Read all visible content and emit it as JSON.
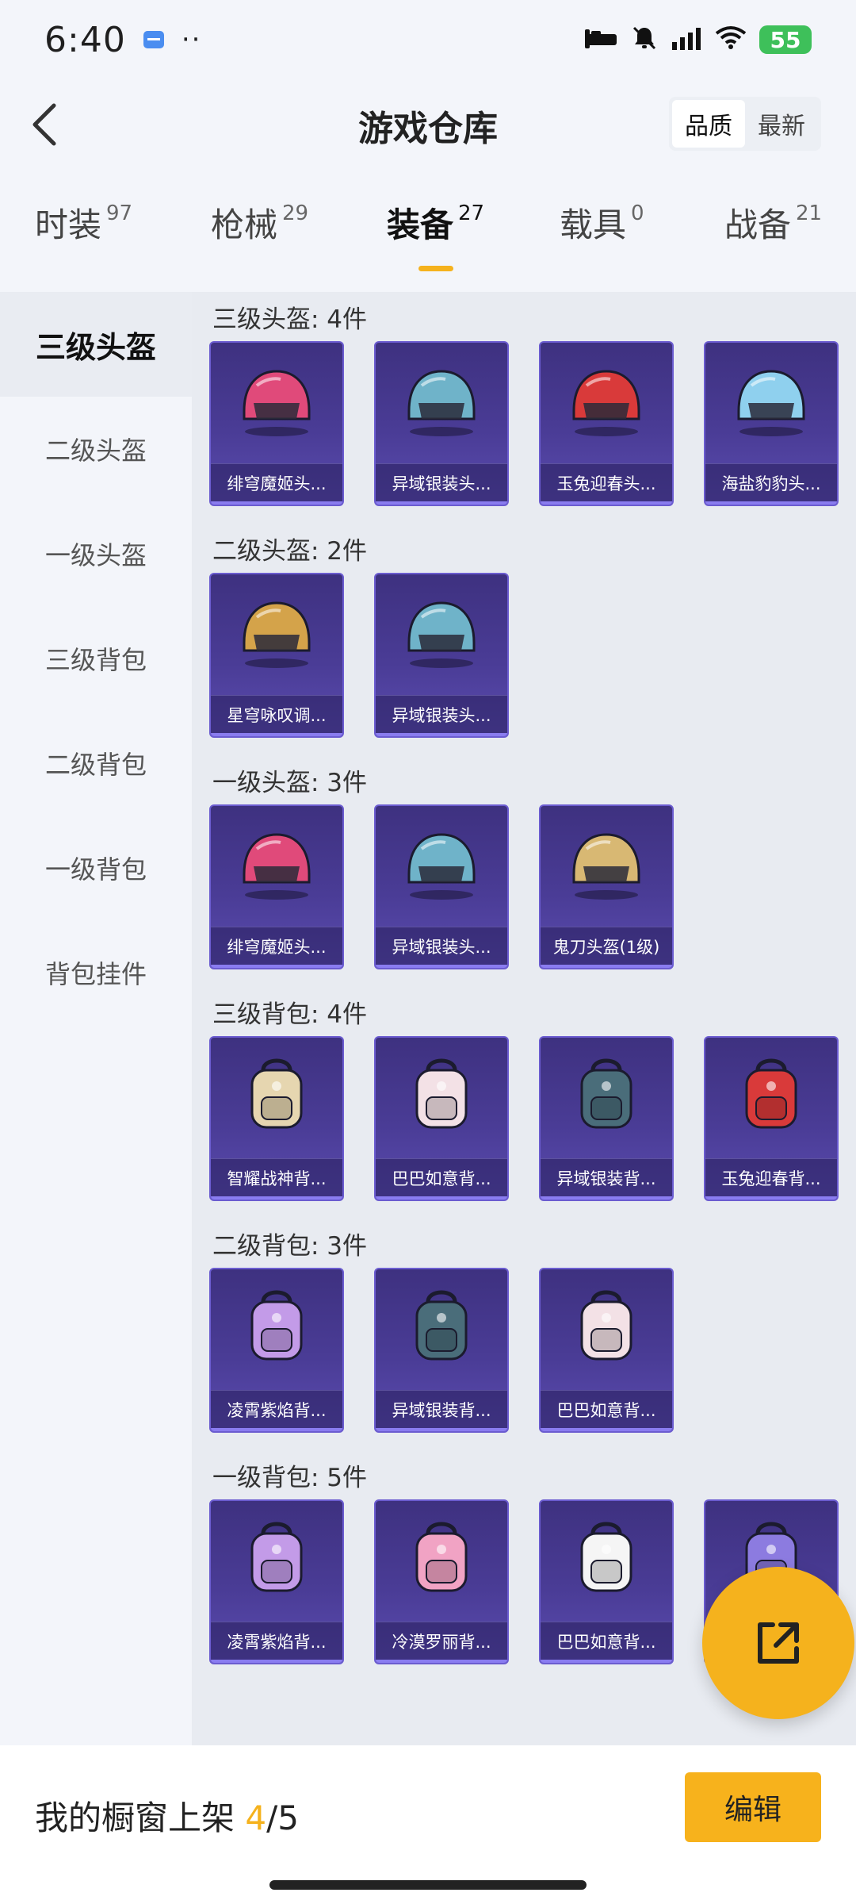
{
  "status_bar": {
    "time": "6:40",
    "dots": "··",
    "battery": "55"
  },
  "header": {
    "title": "游戏仓库",
    "sort_options": [
      "品质",
      "最新"
    ]
  },
  "tabs": [
    {
      "label": "时装",
      "count": "97"
    },
    {
      "label": "枪械",
      "count": "29"
    },
    {
      "label": "装备",
      "count": "27"
    },
    {
      "label": "载具",
      "count": "0"
    },
    {
      "label": "战备",
      "count": "21"
    }
  ],
  "sidebar": {
    "items": [
      "三级头盔",
      "二级头盔",
      "一级头盔",
      "三级背包",
      "二级背包",
      "一级背包",
      "背包挂件"
    ]
  },
  "sections": [
    {
      "title": "三级头盔: 4件",
      "items": [
        {
          "name": "绯穹魔姬头...",
          "icon": "helmet-icon",
          "color": "#e04a7a"
        },
        {
          "name": "异域银装头...",
          "icon": "helmet-icon",
          "color": "#6fb3c9"
        },
        {
          "name": "玉兔迎春头...",
          "icon": "helmet-icon",
          "color": "#d93a3a"
        },
        {
          "name": "海盐豹豹头...",
          "icon": "helmet-icon",
          "color": "#8fd0ee"
        }
      ]
    },
    {
      "title": "二级头盔: 2件",
      "items": [
        {
          "name": "星穹咏叹调...",
          "icon": "helmet-icon",
          "color": "#d4a34a"
        },
        {
          "name": "异域银装头...",
          "icon": "helmet-icon",
          "color": "#6fb3c9"
        }
      ]
    },
    {
      "title": "一级头盔: 3件",
      "items": [
        {
          "name": "绯穹魔姬头...",
          "icon": "helmet-icon",
          "color": "#e04a7a"
        },
        {
          "name": "异域银装头...",
          "icon": "helmet-icon",
          "color": "#6fb3c9"
        },
        {
          "name": "鬼刀头盔(1级)",
          "icon": "helmet-icon",
          "color": "#d8b873"
        }
      ]
    },
    {
      "title": "三级背包: 4件",
      "items": [
        {
          "name": "智耀战神背...",
          "icon": "backpack-icon",
          "color": "#e6d6b0"
        },
        {
          "name": "巴巴如意背...",
          "icon": "backpack-icon",
          "color": "#f3e1e6"
        },
        {
          "name": "异域银装背...",
          "icon": "backpack-icon",
          "color": "#4a6d7a"
        },
        {
          "name": "玉兔迎春背...",
          "icon": "backpack-icon",
          "color": "#d93a3a"
        }
      ]
    },
    {
      "title": "二级背包: 3件",
      "items": [
        {
          "name": "凌霄紫焰背...",
          "icon": "backpack-icon",
          "color": "#c39be8"
        },
        {
          "name": "异域银装背...",
          "icon": "backpack-icon",
          "color": "#4a6d7a"
        },
        {
          "name": "巴巴如意背...",
          "icon": "backpack-icon",
          "color": "#f3e1e6"
        }
      ]
    },
    {
      "title": "一级背包: 5件",
      "items": [
        {
          "name": "凌霄紫焰背...",
          "icon": "backpack-icon",
          "color": "#c39be8"
        },
        {
          "name": "冷漠罗丽背...",
          "icon": "backpack-icon",
          "color": "#f1a3c4"
        },
        {
          "name": "巴巴如意背...",
          "icon": "backpack-icon",
          "color": "#f5f5f5"
        },
        {
          "name": "",
          "icon": "backpack-icon",
          "color": "#8c7be0"
        }
      ]
    }
  ],
  "bottom": {
    "showcase_label": "我的橱窗上架",
    "showcase_current": "4",
    "showcase_total": "/5",
    "edit_label": "编辑"
  },
  "colors": {
    "accent": "#f5b21d",
    "card_bg": "#4a3c96"
  }
}
